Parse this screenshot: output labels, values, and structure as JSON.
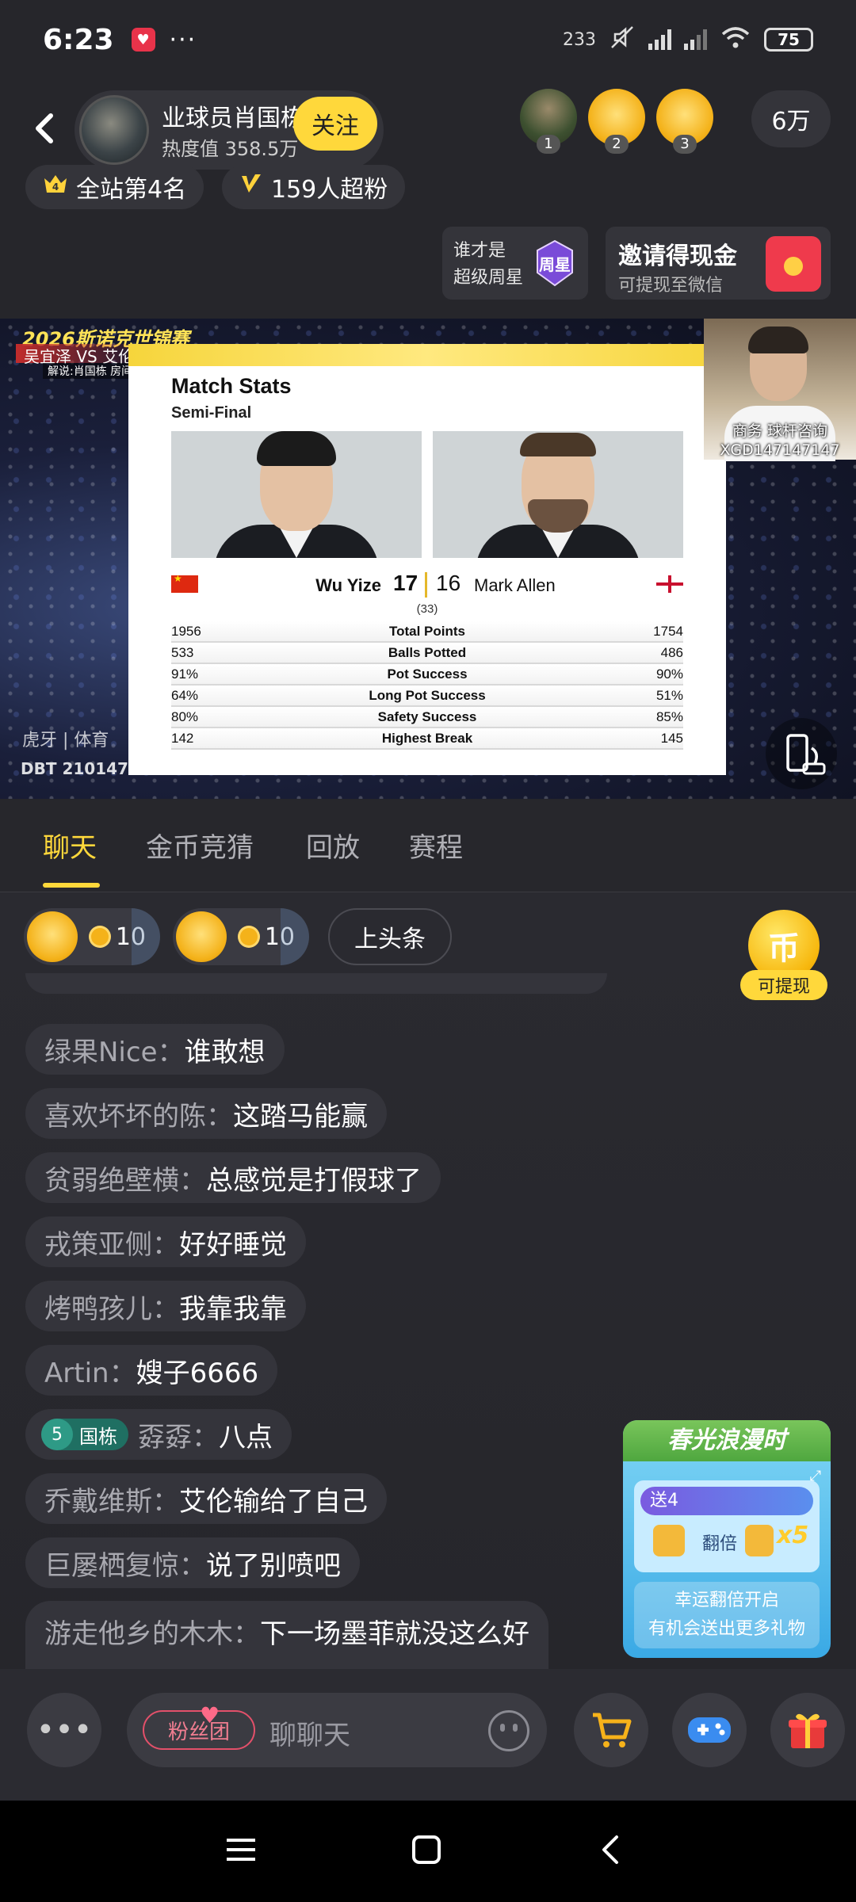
{
  "status_bar": {
    "time": "6:23",
    "speed": "233",
    "battery": "75"
  },
  "header": {
    "streamer_name": "业球员肖国栋",
    "heat_label": "热度值 358.5万",
    "follow_label": "关注",
    "viewer_ranks": [
      "1",
      "2",
      "3"
    ],
    "viewer_count": "6万"
  },
  "badges": {
    "rank": "全站第4名",
    "fans": "159人超粉"
  },
  "promos": {
    "weekstar_line1": "谁才是",
    "weekstar_line2": "超级周星",
    "weekstar_icon_text": "周星",
    "invite_title": "邀请得现金",
    "invite_sub": "可提现至微信"
  },
  "video": {
    "event": "2026斯诺克世锦赛",
    "match": "吴宜泽 VS 艾伦",
    "commentator": "解说:肖国栋 房间号: 210147",
    "cam_caption_1": "商务  球杆咨询",
    "cam_caption_2": "XGD147147147",
    "watermark_huya": "虎牙 | 体育",
    "watermark_dbt": "DBT  210147",
    "stats": {
      "title": "Match Stats",
      "subtitle": "Semi-Final",
      "player1": "Wu Yize",
      "score1": "17",
      "player2": "Mark Allen",
      "score2": "16",
      "frames": "(33)",
      "rows": [
        {
          "left": "1956",
          "label": "Total Points",
          "right": "1754"
        },
        {
          "left": "533",
          "label": "Balls Potted",
          "right": "486"
        },
        {
          "left": "91%",
          "label": "Pot Success",
          "right": "90%"
        },
        {
          "left": "64%",
          "label": "Long Pot Success",
          "right": "51%"
        },
        {
          "left": "80%",
          "label": "Safety Success",
          "right": "85%"
        },
        {
          "left": "142",
          "label": "Highest Break",
          "right": "145"
        }
      ]
    }
  },
  "tabs": [
    "聊天",
    "金币竞猜",
    "回放",
    "赛程"
  ],
  "gifts": [
    {
      "amount": "10"
    },
    {
      "amount": "10"
    }
  ],
  "headline_label": "上头条",
  "coin_widget": {
    "icon": "币",
    "label": "可提现"
  },
  "chat": [
    {
      "user": "绿果Nice：",
      "text": "谁敢想"
    },
    {
      "user": "喜欢坏坏的陈：",
      "text": "这踏马能赢"
    },
    {
      "user": "贫弱绝壁横：",
      "text": "总感觉是打假球了"
    },
    {
      "user": "戎策亚侧：",
      "text": "好好睡觉"
    },
    {
      "user": "烤鸭孩儿：",
      "text": "我靠我靠"
    },
    {
      "user": "Artin：",
      "text": "嫂子6666"
    },
    {
      "user": "孬孬：",
      "text": "八点",
      "fan_level": "5",
      "fan_name": "国栋"
    },
    {
      "user": "乔戴维斯：",
      "text": "艾伦输给了自己"
    },
    {
      "user": "巨屡栖复惊：",
      "text": "说了别喷吧"
    },
    {
      "user": "游走他乡的木木：",
      "text": "下一场墨菲就没这么好"
    }
  ],
  "spring_promo": {
    "title": "春光浪漫时",
    "send_label": "送4",
    "double_label": "翻倍",
    "multiplier": "x5",
    "desc_line1": "幸运翻倍开启",
    "desc_line2": "有机会送出更多礼物"
  },
  "bottom_bar": {
    "fan_club": "粉丝团",
    "placeholder": "聊聊天"
  }
}
